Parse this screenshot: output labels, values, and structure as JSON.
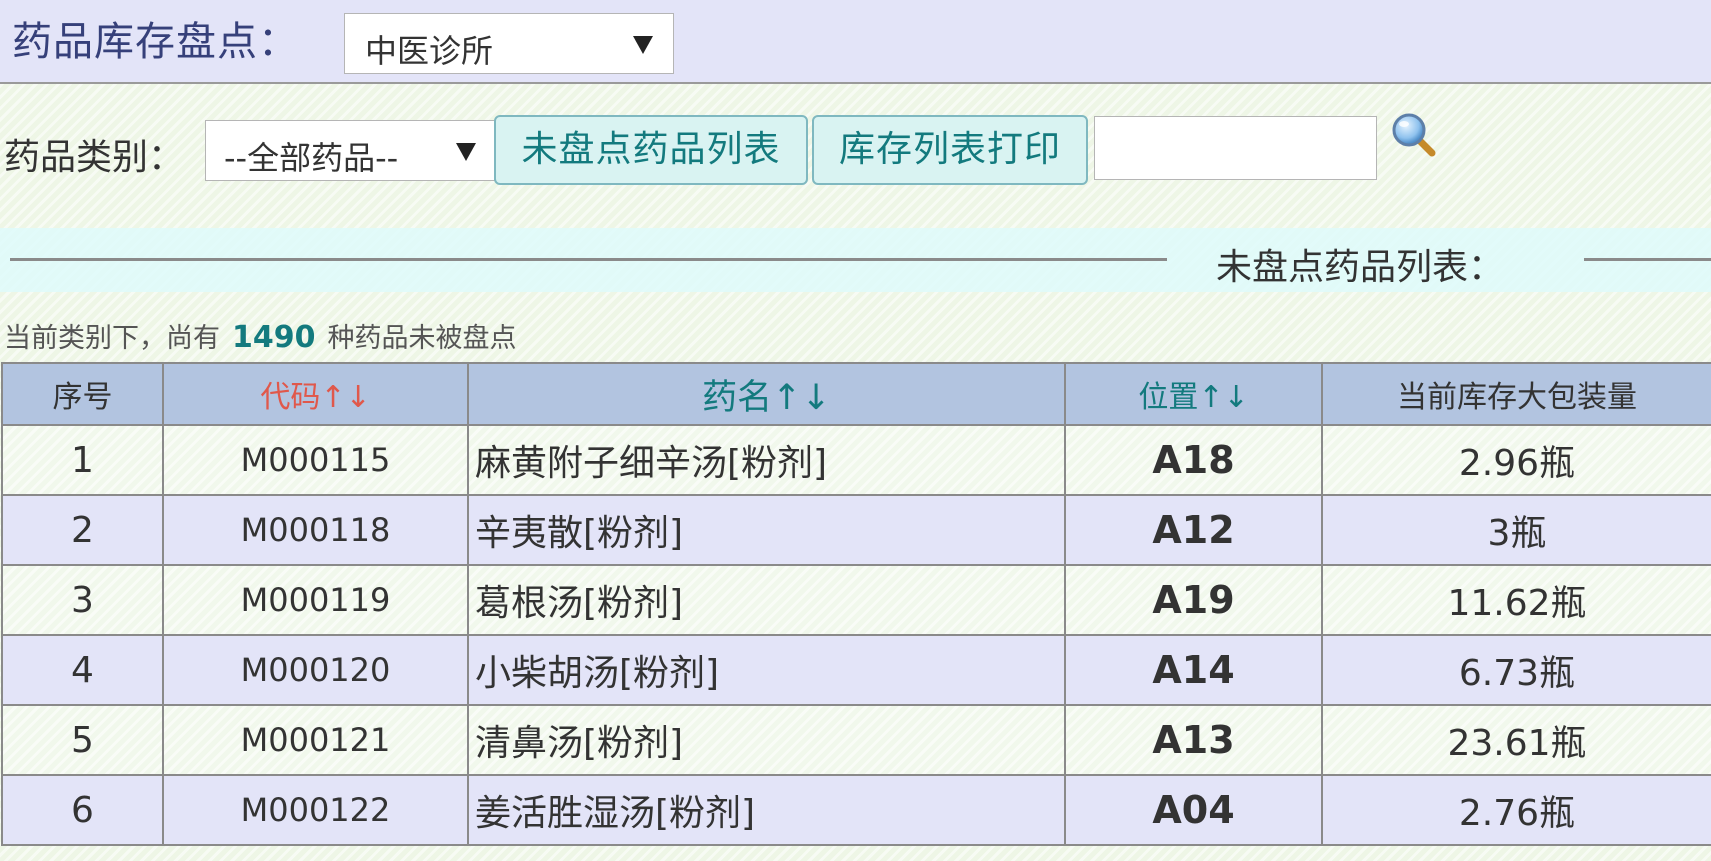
{
  "header": {
    "title": "药品库存盘点：",
    "clinic_select": {
      "value": "中医诊所"
    }
  },
  "filter": {
    "category_label": "药品类别：",
    "category_select": {
      "value": "--全部药品--"
    },
    "unchecked_button_label": "未盘点药品列表",
    "print_button_label": "库存列表打印",
    "search_input": {
      "value": "",
      "placeholder": ""
    },
    "search_icon": "magnifier-icon"
  },
  "section": {
    "title": "未盘点药品列表："
  },
  "summary": {
    "prefix": "当前类别下，尚有",
    "count": "1490",
    "suffix": "种药品未被盘点"
  },
  "table": {
    "columns": [
      "序号",
      "代码↑↓",
      "药名↑↓",
      "位置↑↓",
      "当前库存大包装量"
    ],
    "rows": [
      {
        "index": "1",
        "code": "M000115",
        "name": "麻黄附子细辛汤[粉剂]",
        "position": "A18",
        "stock": "2.96瓶"
      },
      {
        "index": "2",
        "code": "M000118",
        "name": "辛夷散[粉剂]",
        "position": "A12",
        "stock": "3瓶"
      },
      {
        "index": "3",
        "code": "M000119",
        "name": "葛根汤[粉剂]",
        "position": "A19",
        "stock": "11.62瓶"
      },
      {
        "index": "4",
        "code": "M000120",
        "name": "小柴胡汤[粉剂]",
        "position": "A14",
        "stock": "6.73瓶"
      },
      {
        "index": "5",
        "code": "M000121",
        "name": "清鼻汤[粉剂]",
        "position": "A13",
        "stock": "23.61瓶"
      },
      {
        "index": "6",
        "code": "M000122",
        "name": "姜活胜湿汤[粉剂]",
        "position": "A04",
        "stock": "2.76瓶"
      }
    ]
  },
  "colors": {
    "header_bg": "#e3e4f8",
    "accent_teal": "#137a7e",
    "sort_red": "#e0584b",
    "table_header_bg": "#b2c4e0"
  }
}
